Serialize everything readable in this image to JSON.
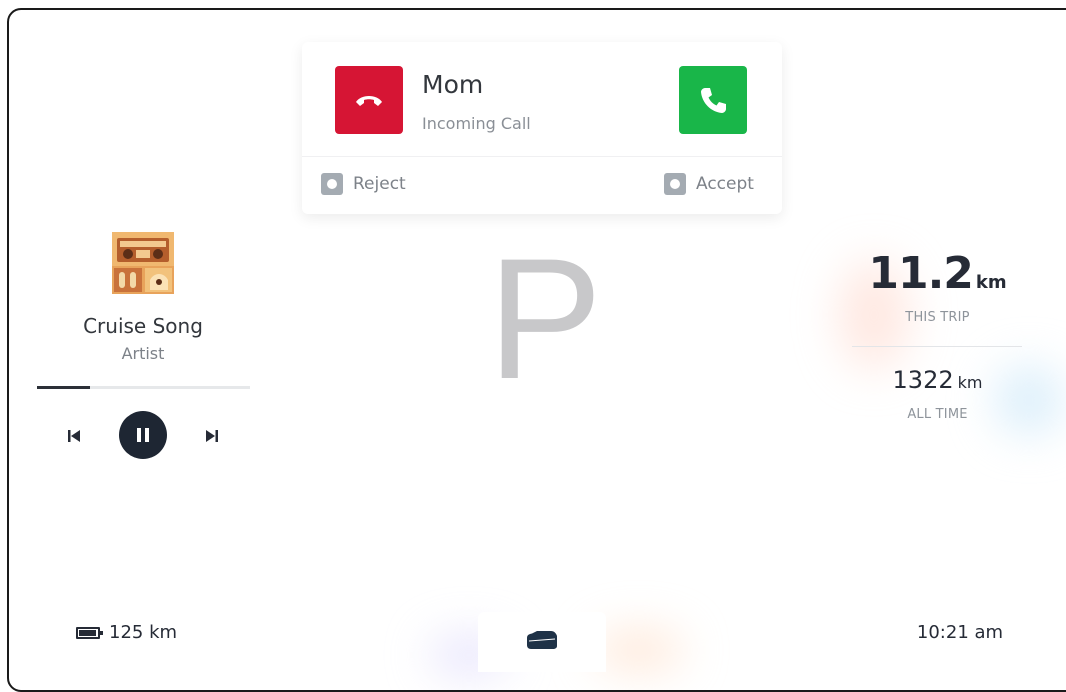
{
  "call": {
    "caller": "Mom",
    "status": "Incoming Call",
    "reject_label": "Reject",
    "accept_label": "Accept",
    "reject_color": "#d61534",
    "accept_color": "#19b649"
  },
  "media": {
    "title": "Cruise Song",
    "artist": "Artist",
    "progress": 0.25
  },
  "gear": "P",
  "trip": {
    "this_trip_value": "11.2",
    "this_trip_unit": "km",
    "this_trip_label": "THIS TRIP",
    "all_time_value": "1322",
    "all_time_unit": "km",
    "all_time_label": "ALL TIME"
  },
  "status_bar": {
    "range": "125 km",
    "time": "10:21 am"
  },
  "icons": {
    "reject": "phone-hangup-icon",
    "accept": "phone-icon",
    "key": "key-button-icon",
    "prev": "skip-previous-icon",
    "play": "pause-icon",
    "next": "skip-next-icon",
    "battery": "battery-icon",
    "car": "car-icon"
  }
}
